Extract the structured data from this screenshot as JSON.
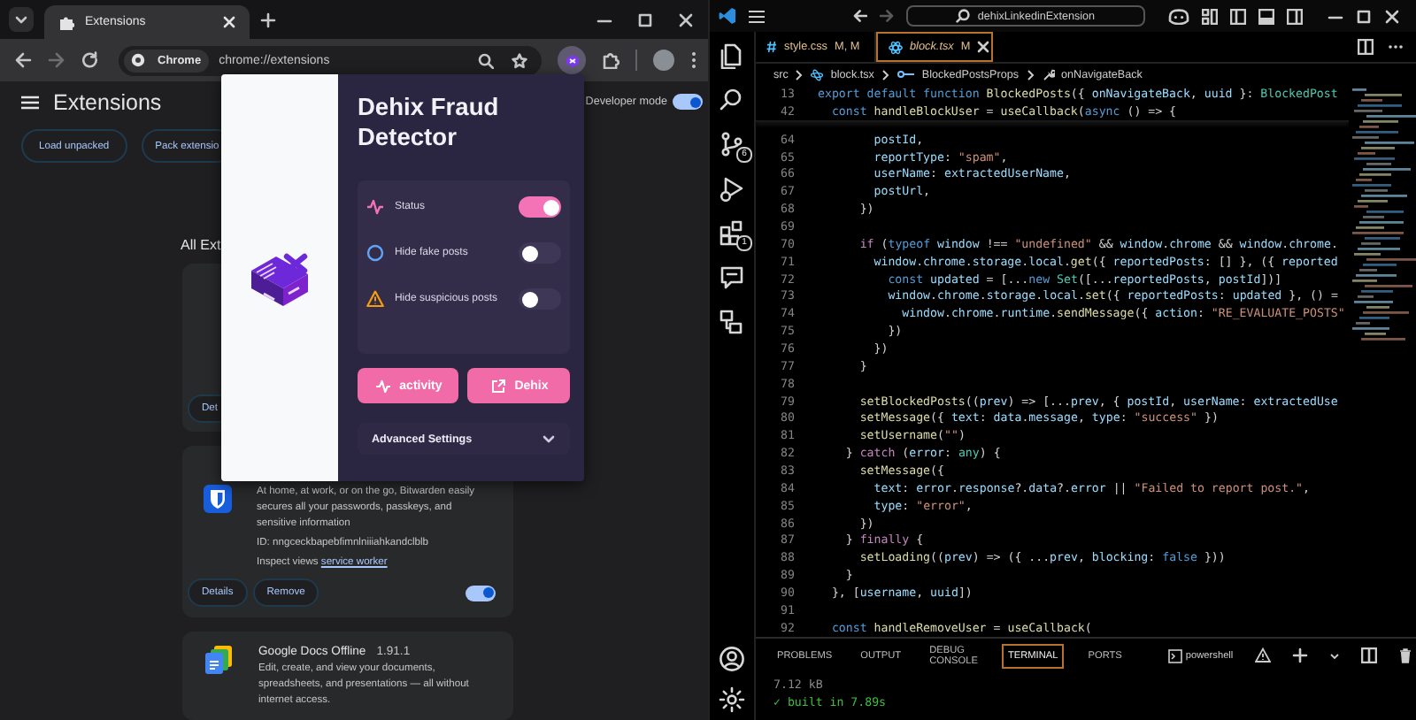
{
  "browser": {
    "tab": {
      "title": "Extensions"
    },
    "address_bar": {
      "chip": "Chrome",
      "url": "chrome://extensions"
    },
    "page": {
      "title": "Extensions",
      "developer_mode": {
        "label": "Developer mode",
        "on": true
      },
      "buttons": [
        "Load unpacked",
        "Pack extensio"
      ],
      "section_heading": "All Ext",
      "cards": [
        {
          "kind": "hidden",
          "buttons": [
            "Det"
          ]
        },
        {
          "kind": "shield",
          "description": "At home, at work, or on the go, Bitwarden easily secures all your passwords, passkeys, and sensitive information",
          "id": "ID: nngceckbapebfimnlniiiahkandclblb",
          "inspect_label": "Inspect views",
          "inspect_link": "service worker",
          "buttons": [
            "Details",
            "Remove"
          ],
          "enabled": true
        },
        {
          "kind": "docs",
          "name": "Google Docs Offline",
          "version": "1.91.1",
          "description": "Edit, create, and view your documents, spreadsheets, and presentations — all without internet access."
        }
      ]
    }
  },
  "popup": {
    "title": "Dehix Fraud Detector",
    "settings": [
      {
        "kind": "pulse",
        "label": "Status",
        "on": true
      },
      {
        "kind": "circle",
        "label": "Hide fake posts",
        "on": false
      },
      {
        "kind": "warning",
        "label": "Hide suspicious posts",
        "on": false
      }
    ],
    "actions": [
      {
        "kind": "pulse",
        "label": "activity"
      },
      {
        "kind": "external",
        "label": "Dehix"
      }
    ],
    "advanced": {
      "label": "Advanced Settings",
      "expanded": false
    }
  },
  "editor": {
    "search": "dehixLinkedinExtension",
    "activity_bar": [
      {
        "kind": "files"
      },
      {
        "kind": "search"
      },
      {
        "kind": "source-control",
        "badge": "6"
      },
      {
        "kind": "run"
      },
      {
        "kind": "extensions",
        "badge": "1"
      },
      {
        "kind": "chat"
      },
      {
        "kind": "remote"
      }
    ],
    "tabs": [
      {
        "kind": "css",
        "name": "style.css",
        "decoration": "M, M",
        "selected": false
      },
      {
        "kind": "tsx",
        "name": "block.tsx",
        "decoration": "M",
        "selected": true
      }
    ],
    "breadcrumb": [
      {
        "kind": "folder",
        "text": "src"
      },
      {
        "kind": "tsx",
        "text": "block.tsx"
      },
      {
        "kind": "interface",
        "text": "BlockedPostsProps"
      },
      {
        "kind": "method",
        "text": "onNavigateBack"
      }
    ],
    "sticky_lines": [
      {
        "no": "13",
        "tokens": [
          {
            "kind": "kw",
            "text": "export default function "
          },
          {
            "kind": "fn",
            "text": "BlockedPosts"
          },
          {
            "kind": "plain",
            "text": "({ "
          },
          {
            "kind": "var",
            "text": "onNavigateBack"
          },
          {
            "kind": "plain",
            "text": ", "
          },
          {
            "kind": "var",
            "text": "uuid"
          },
          {
            "kind": "plain",
            "text": " }: "
          },
          {
            "kind": "type",
            "text": "BlockedPost"
          }
        ]
      },
      {
        "no": "42",
        "tokens": [
          {
            "kind": "kw",
            "text": "  const "
          },
          {
            "kind": "fn",
            "text": "handleBlockUser"
          },
          {
            "kind": "plain",
            "text": " = "
          },
          {
            "kind": "fn",
            "text": "useCallback"
          },
          {
            "kind": "plain",
            "text": "("
          },
          {
            "kind": "kw",
            "text": "async"
          },
          {
            "kind": "plain",
            "text": " () => {"
          }
        ]
      }
    ],
    "lines": [
      {
        "no": "64",
        "tokens": [
          {
            "kind": "var",
            "text": "        postId"
          },
          {
            "kind": "plain",
            "text": ","
          }
        ]
      },
      {
        "no": "65",
        "tokens": [
          {
            "kind": "var",
            "text": "        reportType"
          },
          {
            "kind": "plain",
            "text": ": "
          },
          {
            "kind": "str",
            "text": "\"spam\""
          },
          {
            "kind": "plain",
            "text": ","
          }
        ]
      },
      {
        "no": "66",
        "tokens": [
          {
            "kind": "var",
            "text": "        userName"
          },
          {
            "kind": "plain",
            "text": ": "
          },
          {
            "kind": "var",
            "text": "extractedUserName"
          },
          {
            "kind": "plain",
            "text": ","
          }
        ]
      },
      {
        "no": "67",
        "tokens": [
          {
            "kind": "var",
            "text": "        postUrl"
          },
          {
            "kind": "plain",
            "text": ","
          }
        ]
      },
      {
        "no": "68",
        "tokens": [
          {
            "kind": "plain",
            "text": "      })"
          }
        ]
      },
      {
        "no": "69"
      },
      {
        "no": "70",
        "tokens": [
          {
            "kind": "ctl",
            "text": "      if "
          },
          {
            "kind": "plain",
            "text": "("
          },
          {
            "kind": "kw",
            "text": "typeof "
          },
          {
            "kind": "var",
            "text": "window"
          },
          {
            "kind": "plain",
            "text": " !== "
          },
          {
            "kind": "str",
            "text": "\"undefined\""
          },
          {
            "kind": "plain",
            "text": " && "
          },
          {
            "kind": "var",
            "text": "window"
          },
          {
            "kind": "plain",
            "text": "."
          },
          {
            "kind": "var",
            "text": "chrome"
          },
          {
            "kind": "plain",
            "text": " && "
          },
          {
            "kind": "var",
            "text": "window"
          },
          {
            "kind": "plain",
            "text": "."
          },
          {
            "kind": "var",
            "text": "chrome"
          },
          {
            "kind": "plain",
            "text": "."
          }
        ]
      },
      {
        "no": "71",
        "tokens": [
          {
            "kind": "var",
            "text": "        window.chrome.storage.local."
          },
          {
            "kind": "fn",
            "text": "get"
          },
          {
            "kind": "plain",
            "text": "({ "
          },
          {
            "kind": "var",
            "text": "reportedPosts"
          },
          {
            "kind": "plain",
            "text": ": [] }, ({ "
          },
          {
            "kind": "var",
            "text": "reported"
          }
        ]
      },
      {
        "no": "72",
        "tokens": [
          {
            "kind": "kw",
            "text": "          const "
          },
          {
            "kind": "var",
            "text": "updated"
          },
          {
            "kind": "plain",
            "text": " = [..."
          },
          {
            "kind": "kw",
            "text": "new "
          },
          {
            "kind": "type",
            "text": "Set"
          },
          {
            "kind": "plain",
            "text": "([..."
          },
          {
            "kind": "var",
            "text": "reportedPosts"
          },
          {
            "kind": "plain",
            "text": ", "
          },
          {
            "kind": "var",
            "text": "postId"
          },
          {
            "kind": "plain",
            "text": "])]"
          }
        ]
      },
      {
        "no": "73",
        "tokens": [
          {
            "kind": "var",
            "text": "          window"
          },
          {
            "kind": "plain",
            "text": "."
          },
          {
            "kind": "var",
            "text": "chrome"
          },
          {
            "kind": "plain",
            "text": "."
          },
          {
            "kind": "var",
            "text": "storage"
          },
          {
            "kind": "plain",
            "text": "."
          },
          {
            "kind": "var",
            "text": "local"
          },
          {
            "kind": "plain",
            "text": "."
          },
          {
            "kind": "fn",
            "text": "set"
          },
          {
            "kind": "plain",
            "text": "({ "
          },
          {
            "kind": "var",
            "text": "reportedPosts"
          },
          {
            "kind": "plain",
            "text": ": "
          },
          {
            "kind": "var",
            "text": "updated"
          },
          {
            "kind": "plain",
            "text": " }, () ="
          }
        ]
      },
      {
        "no": "74",
        "tokens": [
          {
            "kind": "var",
            "text": "            window"
          },
          {
            "kind": "plain",
            "text": "."
          },
          {
            "kind": "var",
            "text": "chrome"
          },
          {
            "kind": "plain",
            "text": "."
          },
          {
            "kind": "var",
            "text": "runtime"
          },
          {
            "kind": "plain",
            "text": "."
          },
          {
            "kind": "fn",
            "text": "sendMessage"
          },
          {
            "kind": "plain",
            "text": "({ "
          },
          {
            "kind": "var",
            "text": "action"
          },
          {
            "kind": "plain",
            "text": ": "
          },
          {
            "kind": "str",
            "text": "\"RE_EVALUATE_POSTS\""
          }
        ]
      },
      {
        "no": "75",
        "tokens": [
          {
            "kind": "plain",
            "text": "          })"
          }
        ]
      },
      {
        "no": "76",
        "tokens": [
          {
            "kind": "plain",
            "text": "        })"
          }
        ]
      },
      {
        "no": "77",
        "tokens": [
          {
            "kind": "plain",
            "text": "      }"
          }
        ]
      },
      {
        "no": "78"
      },
      {
        "no": "79",
        "tokens": [
          {
            "kind": "fn",
            "text": "      setBlockedPosts"
          },
          {
            "kind": "plain",
            "text": "(("
          },
          {
            "kind": "var",
            "text": "prev"
          },
          {
            "kind": "plain",
            "text": ") => [..."
          },
          {
            "kind": "var",
            "text": "prev"
          },
          {
            "kind": "plain",
            "text": ", { "
          },
          {
            "kind": "var",
            "text": "postId"
          },
          {
            "kind": "plain",
            "text": ", "
          },
          {
            "kind": "var",
            "text": "userName"
          },
          {
            "kind": "plain",
            "text": ": "
          },
          {
            "kind": "var",
            "text": "extractedUse"
          }
        ]
      },
      {
        "no": "80",
        "tokens": [
          {
            "kind": "fn",
            "text": "      setMessage"
          },
          {
            "kind": "plain",
            "text": "({ "
          },
          {
            "kind": "var",
            "text": "text"
          },
          {
            "kind": "plain",
            "text": ": "
          },
          {
            "kind": "var",
            "text": "data"
          },
          {
            "kind": "plain",
            "text": "."
          },
          {
            "kind": "var",
            "text": "message"
          },
          {
            "kind": "plain",
            "text": ", "
          },
          {
            "kind": "var",
            "text": "type"
          },
          {
            "kind": "plain",
            "text": ": "
          },
          {
            "kind": "str",
            "text": "\"success\""
          },
          {
            "kind": "plain",
            "text": " })"
          }
        ]
      },
      {
        "no": "81",
        "tokens": [
          {
            "kind": "fn",
            "text": "      setUsername"
          },
          {
            "kind": "plain",
            "text": "("
          },
          {
            "kind": "str",
            "text": "\"\""
          },
          {
            "kind": "plain",
            "text": ")"
          }
        ]
      },
      {
        "no": "82",
        "tokens": [
          {
            "kind": "plain",
            "text": "    } "
          },
          {
            "kind": "ctl",
            "text": "catch"
          },
          {
            "kind": "plain",
            "text": " ("
          },
          {
            "kind": "var",
            "text": "error"
          },
          {
            "kind": "plain",
            "text": ": "
          },
          {
            "kind": "type",
            "text": "any"
          },
          {
            "kind": "plain",
            "text": ") {"
          }
        ]
      },
      {
        "no": "83",
        "tokens": [
          {
            "kind": "fn",
            "text": "      setMessage"
          },
          {
            "kind": "plain",
            "text": "({"
          }
        ]
      },
      {
        "no": "84",
        "tokens": [
          {
            "kind": "var",
            "text": "        text"
          },
          {
            "kind": "plain",
            "text": ": "
          },
          {
            "kind": "var",
            "text": "error"
          },
          {
            "kind": "plain",
            "text": "."
          },
          {
            "kind": "var",
            "text": "response"
          },
          {
            "kind": "plain",
            "text": "?."
          },
          {
            "kind": "var",
            "text": "data"
          },
          {
            "kind": "plain",
            "text": "?."
          },
          {
            "kind": "var",
            "text": "error"
          },
          {
            "kind": "plain",
            "text": " || "
          },
          {
            "kind": "str",
            "text": "\"Failed to report post.\""
          },
          {
            "kind": "plain",
            "text": ","
          }
        ]
      },
      {
        "no": "85",
        "tokens": [
          {
            "kind": "var",
            "text": "        type"
          },
          {
            "kind": "plain",
            "text": ": "
          },
          {
            "kind": "str",
            "text": "\"error\""
          },
          {
            "kind": "plain",
            "text": ","
          }
        ]
      },
      {
        "no": "86",
        "tokens": [
          {
            "kind": "plain",
            "text": "      })"
          }
        ]
      },
      {
        "no": "87",
        "tokens": [
          {
            "kind": "plain",
            "text": "    } "
          },
          {
            "kind": "ctl",
            "text": "finally"
          },
          {
            "kind": "plain",
            "text": " {"
          }
        ]
      },
      {
        "no": "88",
        "tokens": [
          {
            "kind": "fn",
            "text": "      setLoading"
          },
          {
            "kind": "plain",
            "text": "(("
          },
          {
            "kind": "var",
            "text": "prev"
          },
          {
            "kind": "plain",
            "text": ") => ({ ..."
          },
          {
            "kind": "var",
            "text": "prev"
          },
          {
            "kind": "plain",
            "text": ", "
          },
          {
            "kind": "var",
            "text": "blocking"
          },
          {
            "kind": "plain",
            "text": ": "
          },
          {
            "kind": "kw",
            "text": "false"
          },
          {
            "kind": "plain",
            "text": " }))"
          }
        ]
      },
      {
        "no": "89",
        "tokens": [
          {
            "kind": "plain",
            "text": "    }"
          }
        ]
      },
      {
        "no": "90",
        "tokens": [
          {
            "kind": "plain",
            "text": "  }, ["
          },
          {
            "kind": "var",
            "text": "username"
          },
          {
            "kind": "plain",
            "text": ", "
          },
          {
            "kind": "var",
            "text": "uuid"
          },
          {
            "kind": "plain",
            "text": "])"
          }
        ]
      },
      {
        "no": "91"
      },
      {
        "no": "92",
        "tokens": [
          {
            "kind": "kw",
            "text": "  const "
          },
          {
            "kind": "fn",
            "text": "handleRemoveUser"
          },
          {
            "kind": "plain",
            "text": " = "
          },
          {
            "kind": "fn",
            "text": "useCallback"
          },
          {
            "kind": "plain",
            "text": "("
          }
        ]
      }
    ],
    "panel": {
      "tabs": [
        {
          "label": "PROBLEMS",
          "selected": false
        },
        {
          "label": "OUTPUT",
          "selected": false
        },
        {
          "label": "DEBUG CONSOLE",
          "selected": false
        },
        {
          "label": "TERMINAL",
          "selected": true
        },
        {
          "label": "PORTS",
          "selected": false
        }
      ],
      "shell": "powershell",
      "terminal_lines": [
        {
          "kind": "muted",
          "text": "7.12 kB"
        },
        {
          "kind": "success",
          "text": "✓ built in 7.89s"
        }
      ]
    }
  }
}
